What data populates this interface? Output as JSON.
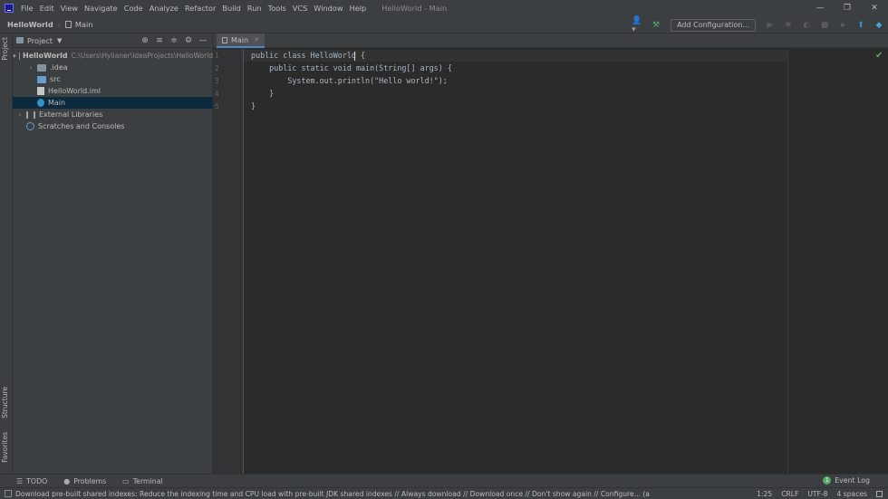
{
  "menu": [
    "File",
    "Edit",
    "View",
    "Navigate",
    "Code",
    "Analyze",
    "Refactor",
    "Build",
    "Run",
    "Tools",
    "VCS",
    "Window",
    "Help"
  ],
  "window_title": "HelloWorld - Main",
  "window_controls": {
    "minimize": "—",
    "restore": "❐",
    "close": "✕"
  },
  "breadcrumb": {
    "project": "HelloWorld",
    "file": "Main"
  },
  "toolbar": {
    "add_configuration": "Add Configuration..."
  },
  "project_panel": {
    "title": "Project",
    "tree": [
      {
        "label": "HelloWorld",
        "path": "C:\\Users\\Hylianer\\IdeaProjects\\HelloWorld",
        "kind": "project",
        "expanded": true
      },
      {
        "label": ".idea",
        "kind": "folder",
        "expanded": false
      },
      {
        "label": "src",
        "kind": "source-folder"
      },
      {
        "label": "HelloWorld.iml",
        "kind": "iml"
      },
      {
        "label": "Main",
        "kind": "java",
        "selected": true
      },
      {
        "label": "External Libraries",
        "kind": "libraries",
        "expanded": false
      },
      {
        "label": "Scratches and Consoles",
        "kind": "scratches"
      }
    ]
  },
  "left_strip": {
    "project": "Project",
    "structure": "Structure",
    "favorites": "Favorites"
  },
  "editor": {
    "tab": "Main",
    "line_numbers": [
      "1",
      "2",
      "3",
      "4",
      "5"
    ],
    "lines": [
      "public class HelloWorld {",
      "    public static void main(String[] args) {",
      "        System.out.println(\"Hello world!\");",
      "    }",
      "}"
    ],
    "cursor": "1:25"
  },
  "bottom_tabs": {
    "todo": "TODO",
    "problems": "Problems",
    "terminal": "Terminal",
    "event_log": "Event Log"
  },
  "status": {
    "message": "Download pre-built shared indexes: Reduce the indexing time and CPU load with pre-built JDK shared indexes // Always download // Download once // Don't show again // Configure... (a minute ago)",
    "position": "1:25",
    "line_sep": "CRLF",
    "encoding": "UTF-8",
    "indent": "4 spaces"
  },
  "colors": {
    "background": "#2b2b2b",
    "panel": "#3c3f41",
    "selection": "#0d293e",
    "accent": "#4a88c7",
    "ok": "#59a869"
  }
}
